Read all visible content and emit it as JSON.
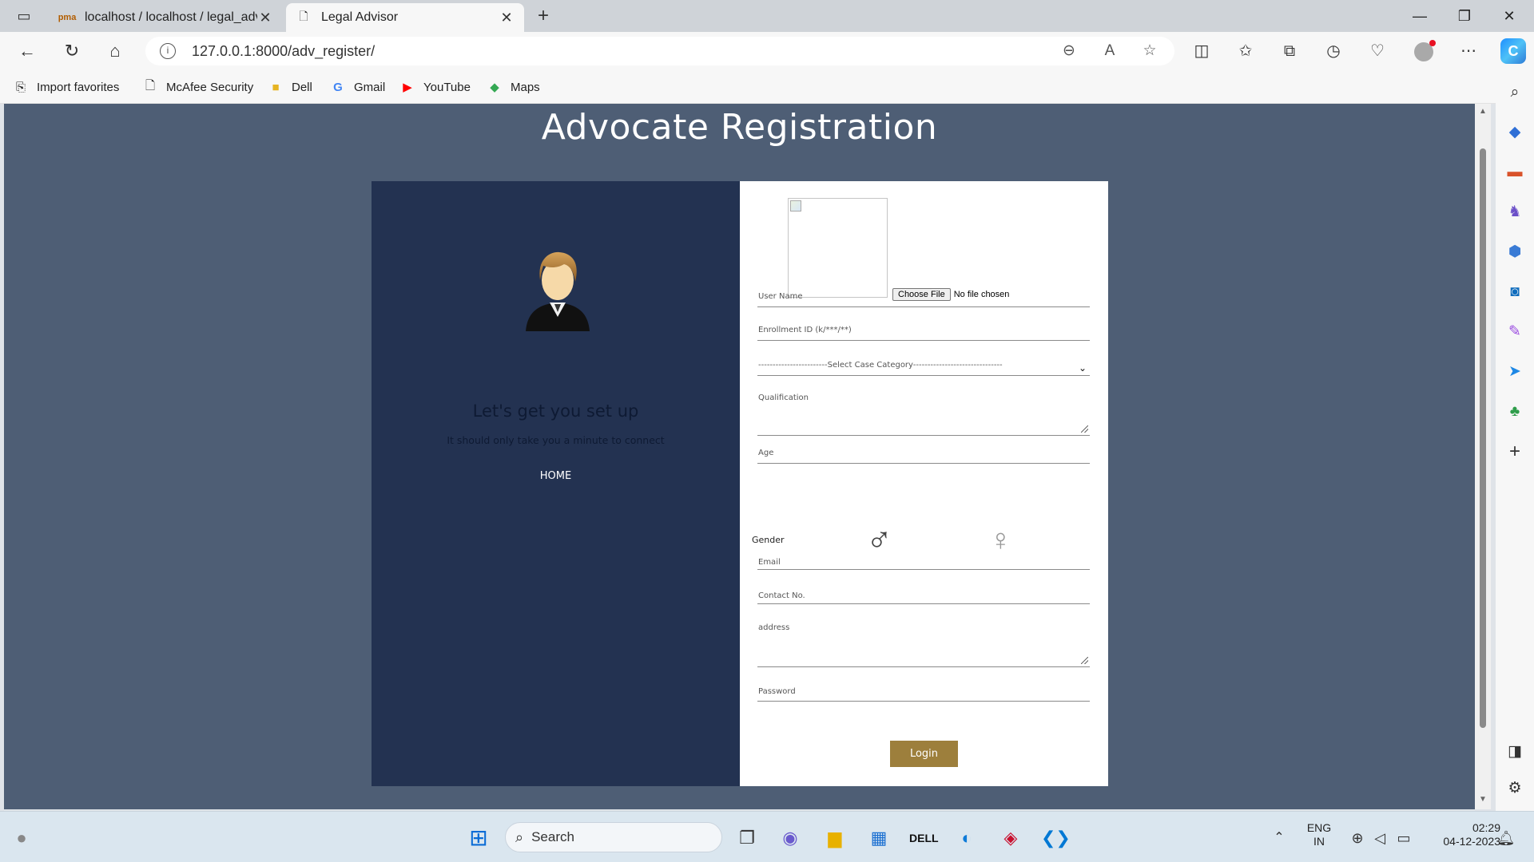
{
  "browser": {
    "tabs": [
      {
        "title": "localhost / localhost / legal_advis",
        "active": false,
        "icon": "phpmyadmin-icon"
      },
      {
        "title": "Legal Advisor",
        "active": true,
        "icon": "page-icon"
      }
    ],
    "address": "127.0.0.1:8000/adv_register/",
    "bookmarks": [
      {
        "label": "Import favorites",
        "icon": "import-icon"
      },
      {
        "label": "McAfee Security",
        "icon": "page-icon"
      },
      {
        "label": "Dell",
        "icon": "folder-icon"
      },
      {
        "label": "Gmail",
        "icon": "google-icon"
      },
      {
        "label": "YouTube",
        "icon": "youtube-icon"
      },
      {
        "label": "Maps",
        "icon": "maps-icon"
      }
    ]
  },
  "page": {
    "title": "Advocate Registration",
    "left_panel": {
      "heading": "Let's get you set up",
      "subtext": "It should only take you a minute to connect",
      "home_link": "HOME"
    },
    "form": {
      "file_button": "Choose File",
      "file_status": "No file chosen",
      "fields": {
        "username": "User Name",
        "enrollment": "Enrollment ID (k/***/**)",
        "category": "------------------------Select Case Category-------------------------------",
        "qualification": "Qualification",
        "age": "Age",
        "gender": "Gender",
        "email": "Email",
        "contact": "Contact No.",
        "address": "address",
        "password": "Password"
      },
      "submit": "Login"
    }
  },
  "taskbar": {
    "search_placeholder": "Search",
    "lang_line1": "ENG",
    "lang_line2": "IN",
    "time": "02:29",
    "date": "04-12-2023"
  },
  "colors": {
    "page_bg": "#4e5e75",
    "left_panel": "#233251",
    "login_button": "#9d7f3c"
  }
}
